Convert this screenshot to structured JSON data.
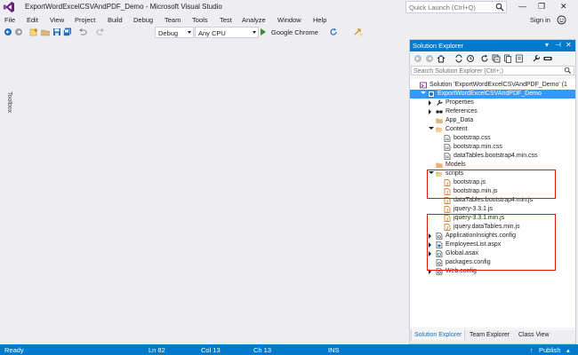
{
  "window": {
    "title": "ExportWordExcelCSVAndPDF_Demo - Microsoft Visual Studio"
  },
  "quick_launch": {
    "placeholder": "Quick Launch (Ctrl+Q)"
  },
  "menu": {
    "items": [
      "File",
      "Edit",
      "View",
      "Project",
      "Build",
      "Debug",
      "Team",
      "Tools",
      "Test",
      "Analyze",
      "Window",
      "Help"
    ]
  },
  "signin_label": "Sign in",
  "toolbar": {
    "configuration": "Debug",
    "platform": "Any CPU",
    "start_label": "Google Chrome"
  },
  "toolbox_label": "Toolbox",
  "solution_explorer": {
    "title": "Solution Explorer",
    "search_placeholder": "Search Solution Explorer (Ctrl+;)",
    "tree": [
      {
        "label": "Solution 'ExportWordExcelCSVAndPDF_Demo' (1",
        "icon": "solution-icon",
        "expander": "none"
      },
      {
        "label": "ExportWordExcelCSVAndPDF_Demo",
        "icon": "web-project-icon",
        "expander": "open",
        "selected": true
      },
      {
        "label": "Properties",
        "icon": "wrench-icon",
        "expander": "closed"
      },
      {
        "label": "References",
        "icon": "references-icon",
        "expander": "closed"
      },
      {
        "label": "App_Data",
        "icon": "folder-icon",
        "expander": "none"
      },
      {
        "label": "Content",
        "icon": "folder-open-icon",
        "expander": "open"
      },
      {
        "label": "bootstrap.css",
        "icon": "css-file-icon",
        "expander": "none"
      },
      {
        "label": "bootstrap.min.css",
        "icon": "css-file-icon",
        "expander": "none"
      },
      {
        "label": "dataTables.bootstrap4.min.css",
        "icon": "css-file-icon",
        "expander": "none"
      },
      {
        "label": "Models",
        "icon": "folder-icon",
        "expander": "none"
      },
      {
        "label": "scripts",
        "icon": "folder-open-icon",
        "expander": "open"
      },
      {
        "label": "bootstrap.js",
        "icon": "js-file-icon",
        "expander": "none"
      },
      {
        "label": "bootstrap.min.js",
        "icon": "js-file-icon",
        "expander": "none"
      },
      {
        "label": "dataTables.bootstrap4.min.js",
        "icon": "js-file-icon",
        "expander": "none"
      },
      {
        "label": "jquery-3.3.1.js",
        "icon": "js-file-icon",
        "expander": "none"
      },
      {
        "label": "jquery-3.3.1.min.js",
        "icon": "js-file-icon",
        "expander": "none"
      },
      {
        "label": "jquery.dataTables.min.js",
        "icon": "js-file-icon",
        "expander": "none"
      },
      {
        "label": "ApplicationInsights.config",
        "icon": "config-file-icon",
        "expander": "closed"
      },
      {
        "label": "EmployeesList.aspx",
        "icon": "aspx-file-icon",
        "expander": "closed"
      },
      {
        "label": "Global.asax",
        "icon": "asax-file-icon",
        "expander": "closed"
      },
      {
        "label": "packages.config",
        "icon": "config-file-icon",
        "expander": "none"
      },
      {
        "label": "Web.config",
        "icon": "config-file-icon",
        "expander": "closed"
      }
    ],
    "tabs": [
      "Solution Explorer",
      "Team Explorer",
      "Class View"
    ]
  },
  "status": {
    "ready": "Ready",
    "line": "Ln 82",
    "col": "Col 13",
    "ch": "Ch 13",
    "mode": "INS",
    "publish": "Publish"
  },
  "colors": {
    "accent": "#007acc",
    "highlight": "#e51400",
    "vs_purple": "#68217a"
  }
}
